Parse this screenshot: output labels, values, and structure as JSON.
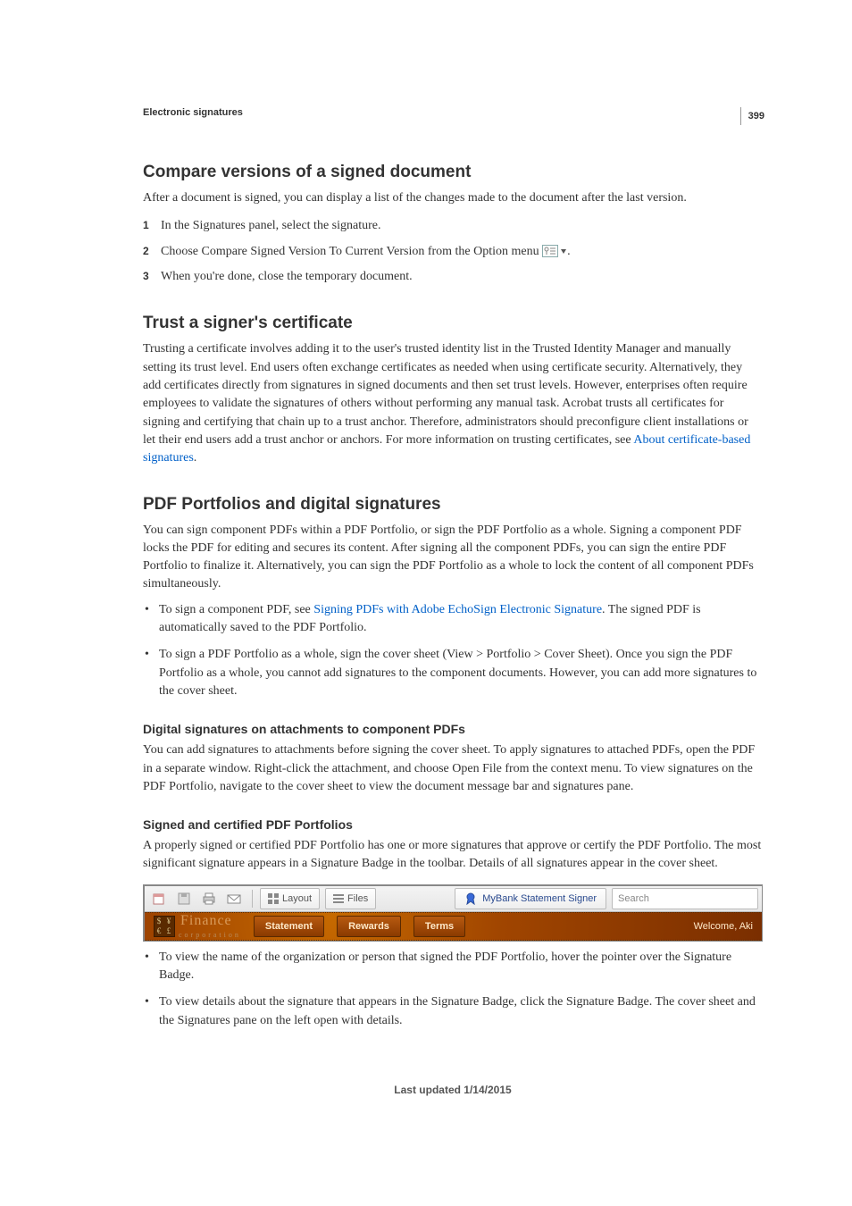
{
  "page_number": "399",
  "breadcrumb": "Electronic signatures",
  "section1": {
    "heading": "Compare versions of a signed document",
    "intro": "After a document is signed, you can display a list of the changes made to the document after the last version.",
    "steps": [
      "In the Signatures panel, select the signature.",
      "Choose Compare Signed Version To Current Version from the Option menu ",
      "When you're done, close the temporary document."
    ],
    "step2_suffix": "."
  },
  "section2": {
    "heading": "Trust a signer's certificate",
    "body": "Trusting a certificate involves adding it to the user's trusted identity list in the Trusted Identity Manager and manually setting its trust level. End users often exchange certificates as needed when using certificate security. Alternatively, they add certificates directly from signatures in signed documents and then set trust levels. However, enterprises often require employees to validate the signatures of others without performing any manual task. Acrobat trusts all certificates for signing and certifying that chain up to a trust anchor. Therefore, administrators should preconfigure client installations or let their end users add a trust anchor or anchors. For more information on trusting certificates, see ",
    "link": "About certificate-based signatures",
    "body_suffix": "."
  },
  "section3": {
    "heading": "PDF Portfolios and digital signatures",
    "intro": "You can sign component PDFs within a PDF Portfolio, or sign the PDF Portfolio as a whole. Signing a component PDF locks the PDF for editing and secures its content. After signing all the component PDFs, you can sign the entire PDF Portfolio to finalize it. Alternatively, you can sign the PDF Portfolio as a whole to lock the content of all component PDFs simultaneously.",
    "bullets": [
      {
        "pre": "To sign a component PDF, see ",
        "link": "Signing PDFs with Adobe EchoSign Electronic Signature",
        "post": ". The signed PDF is automatically saved to the PDF Portfolio."
      },
      {
        "pre": "To sign a PDF Portfolio as a whole, sign the cover sheet (View > Portfolio > Cover Sheet). Once you sign the PDF Portfolio as a whole, you cannot add signatures to the component documents. However, you can add more signatures to the cover sheet.",
        "link": "",
        "post": ""
      }
    ],
    "sub1": {
      "heading": "Digital signatures on attachments to component PDFs",
      "body": "You can add signatures to attachments before signing the cover sheet. To apply signatures to attached PDFs, open the PDF in a separate window. Right-click the attachment, and choose Open File from the context menu. To view signatures on the PDF Portfolio, navigate to the cover sheet to view the document message bar and signatures pane."
    },
    "sub2": {
      "heading": "Signed and certified PDF Portfolios",
      "body": "A properly signed or certified PDF Portfolio has one or more signatures that approve or certify the PDF Portfolio. The most significant signature appears in a Signature Badge in the toolbar. Details of all signatures appear in the cover sheet."
    },
    "figure": {
      "layout_label": "Layout",
      "files_label": "Files",
      "badge_text": "MyBank Statement Signer",
      "search_placeholder": "Search",
      "brand": "Finance",
      "brand_sub": "corporation",
      "nav": [
        "Statement",
        "Rewards",
        "Terms"
      ],
      "welcome": "Welcome, Aki"
    },
    "post_bullets": [
      "To view the name of the organization or person that signed the PDF Portfolio, hover the pointer over the Signature Badge.",
      "To view details about the signature that appears in the Signature Badge, click the Signature Badge. The cover sheet and the Signatures pane on the left open with details."
    ]
  },
  "footer": "Last updated 1/14/2015"
}
